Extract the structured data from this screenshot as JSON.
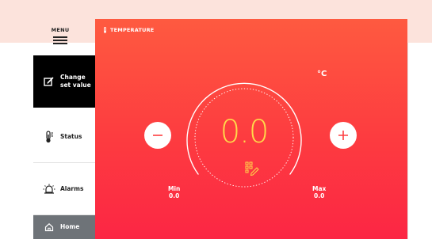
{
  "sidebar": {
    "menu_label": "MENU",
    "items": [
      {
        "label_line1": "Change",
        "label_line2": "set value",
        "icon": "edit-icon",
        "active": true
      },
      {
        "label": "Status",
        "icon": "thermometer-icon"
      },
      {
        "label": "Alarms",
        "icon": "alarm-icon"
      },
      {
        "label": "Home",
        "icon": "home-icon"
      }
    ]
  },
  "panel": {
    "title": "TEMPERATURE",
    "unit": "°C",
    "value": "0.0",
    "min_label": "Min",
    "min_value": "0.0",
    "max_label": "Max",
    "max_value": "0.0",
    "minus_icon": "minus-icon",
    "plus_icon": "plus-icon"
  },
  "colors": {
    "panel_top": "#fe5a40",
    "panel_bottom": "#fc2644",
    "value": "#ffd94a",
    "active_item": "#000000",
    "home_item": "#6e7378"
  }
}
